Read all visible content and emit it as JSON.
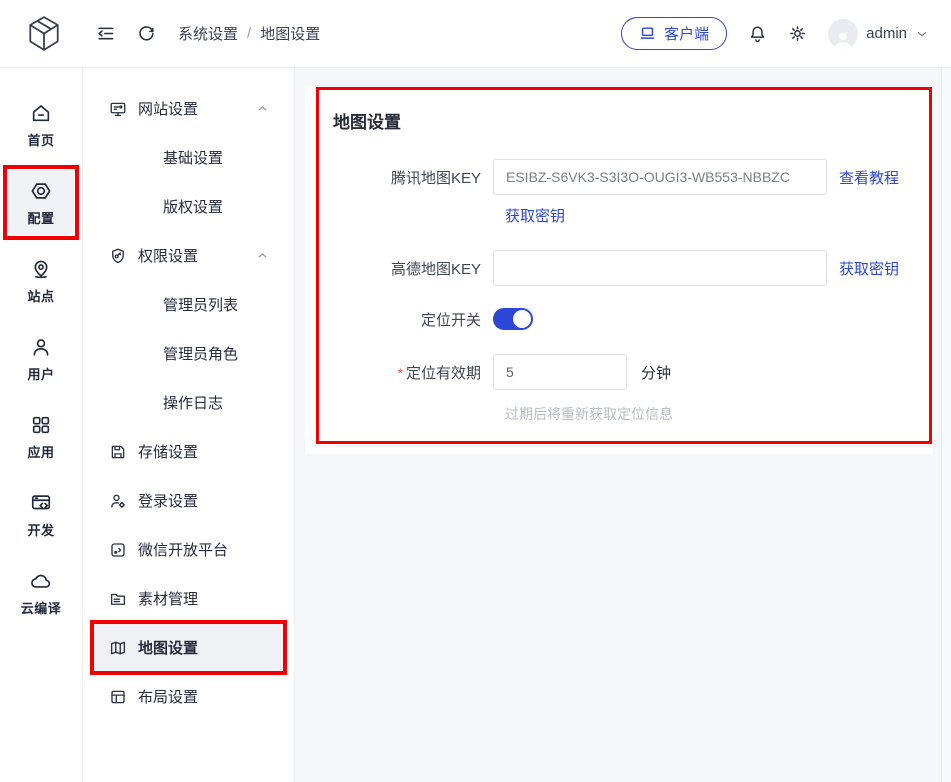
{
  "theme": {
    "primary": "#2c47d8",
    "annotation_red": "#f20000",
    "active_bg": "#f1f2f5"
  },
  "header": {
    "logo_icon": "cube-logo",
    "collapse_icon": "fold-icon",
    "refresh_icon": "refresh-icon",
    "breadcrumb": [
      "系统设置",
      "地图设置"
    ],
    "breadcrumb_separator": "/",
    "client_button": {
      "label": "客户端",
      "icon": "laptop-icon"
    },
    "bell_icon": "bell-icon",
    "gear_icon": "gear-icon",
    "username": "admin",
    "chevron_icon": "chevron-down-icon"
  },
  "rail": {
    "items": [
      {
        "name": "home",
        "label": "首页",
        "icon": "home",
        "active": false,
        "annotated": false
      },
      {
        "name": "config",
        "label": "配置",
        "icon": "nut",
        "active": true,
        "annotated": true
      },
      {
        "name": "site",
        "label": "站点",
        "icon": "pin",
        "active": false,
        "annotated": false
      },
      {
        "name": "user",
        "label": "用户",
        "icon": "user",
        "active": false,
        "annotated": false
      },
      {
        "name": "apps",
        "label": "应用",
        "icon": "apps",
        "active": false,
        "annotated": false
      },
      {
        "name": "dev",
        "label": "开发",
        "icon": "dev",
        "active": false,
        "annotated": false
      },
      {
        "name": "cloud-build",
        "label": "云编译",
        "icon": "cloud",
        "active": false,
        "annotated": false
      }
    ]
  },
  "menu": {
    "items": [
      {
        "name": "website-settings",
        "label": "网站设置",
        "icon": "monitor",
        "type": "group",
        "expanded": true
      },
      {
        "name": "basic-settings",
        "label": "基础设置",
        "type": "child"
      },
      {
        "name": "copyright-settings",
        "label": "版权设置",
        "type": "child"
      },
      {
        "name": "permission-settings",
        "label": "权限设置",
        "icon": "shield",
        "type": "group",
        "expanded": true
      },
      {
        "name": "admin-list",
        "label": "管理员列表",
        "type": "child"
      },
      {
        "name": "admin-roles",
        "label": "管理员角色",
        "type": "child"
      },
      {
        "name": "operation-logs",
        "label": "操作日志",
        "type": "child"
      },
      {
        "name": "storage-settings",
        "label": "存储设置",
        "icon": "save",
        "type": "leaf"
      },
      {
        "name": "login-settings",
        "label": "登录设置",
        "icon": "user-gear",
        "type": "leaf"
      },
      {
        "name": "wechat-open-platform",
        "label": "微信开放平台",
        "icon": "wechat-dev",
        "type": "leaf"
      },
      {
        "name": "material-management",
        "label": "素材管理",
        "icon": "folder",
        "type": "leaf"
      },
      {
        "name": "map-settings",
        "label": "地图设置",
        "icon": "map",
        "type": "leaf",
        "active": true,
        "annotated": true
      },
      {
        "name": "layout-settings",
        "label": "布局设置",
        "icon": "layout",
        "type": "leaf"
      }
    ]
  },
  "form": {
    "title": "地图设置",
    "tencent_label": "腾讯地图KEY",
    "tencent_value": "ESIBZ-S6VK3-S3I3O-OUGI3-WB553-NBBZC",
    "tencent_tutorial_link": "查看教程",
    "tencent_key_link": "获取密钥",
    "amap_label": "高德地图KEY",
    "amap_value": "",
    "amap_key_link": "获取密钥",
    "toggle_label": "定位开关",
    "toggle_on": true,
    "validity_required_mark": "*",
    "validity_label": "定位有效期",
    "validity_value": "5",
    "validity_unit": "分钟",
    "validity_help": "过期后将重新获取定位信息"
  }
}
